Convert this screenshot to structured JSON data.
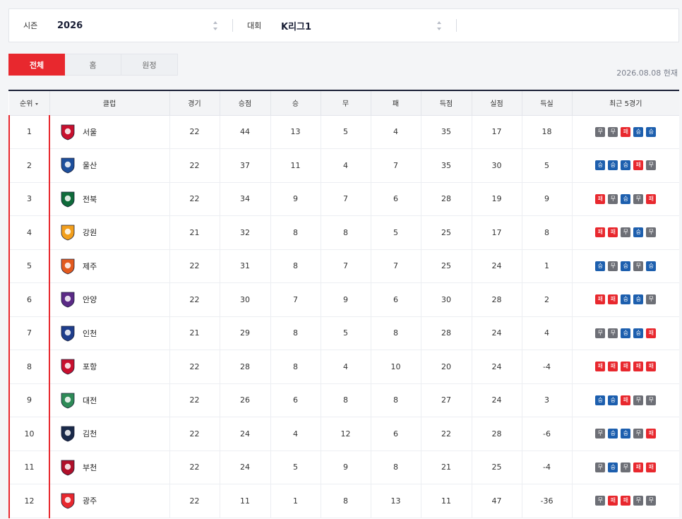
{
  "filters": {
    "season_label": "시즌",
    "season_value": "2026",
    "competition_label": "대회",
    "competition_value": "K리그1"
  },
  "tabs": [
    {
      "label": "전체",
      "active": true
    },
    {
      "label": "홈",
      "active": false
    },
    {
      "label": "원정",
      "active": false
    }
  ],
  "as_of": "2026.08.08 현재",
  "table": {
    "headers": {
      "rank": "순위",
      "club": "클럽",
      "played": "경기",
      "points": "승점",
      "won": "승",
      "drawn": "무",
      "lost": "패",
      "gf": "득점",
      "ga": "실점",
      "gd": "득실",
      "recent": "최근 5경기"
    },
    "result_labels": {
      "W": "승",
      "D": "무",
      "L": "패"
    },
    "colors": {
      "win": "#1d5fae",
      "draw": "#6d6f76",
      "loss": "#e8282e",
      "accent": "#e8282e"
    },
    "rows": [
      {
        "rank": "1",
        "club": "서울",
        "crest_color": "#c8102e",
        "played": "22",
        "points": "44",
        "won": "13",
        "drawn": "5",
        "lost": "4",
        "gf": "35",
        "ga": "17",
        "gd": "18",
        "recent": [
          "D",
          "D",
          "L",
          "W",
          "W"
        ]
      },
      {
        "rank": "2",
        "club": "울산",
        "crest_color": "#1d4f9c",
        "played": "22",
        "points": "37",
        "won": "11",
        "drawn": "4",
        "lost": "7",
        "gf": "35",
        "ga": "30",
        "gd": "5",
        "recent": [
          "W",
          "W",
          "W",
          "L",
          "D"
        ]
      },
      {
        "rank": "3",
        "club": "전북",
        "crest_color": "#0f6b3a",
        "played": "22",
        "points": "34",
        "won": "9",
        "drawn": "7",
        "lost": "6",
        "gf": "28",
        "ga": "19",
        "gd": "9",
        "recent": [
          "L",
          "D",
          "W",
          "D",
          "L"
        ]
      },
      {
        "rank": "4",
        "club": "강원",
        "crest_color": "#f29f1c",
        "played": "21",
        "points": "32",
        "won": "8",
        "drawn": "8",
        "lost": "5",
        "gf": "25",
        "ga": "17",
        "gd": "8",
        "recent": [
          "L",
          "L",
          "D",
          "W",
          "D"
        ]
      },
      {
        "rank": "5",
        "club": "제주",
        "crest_color": "#e35a1e",
        "played": "22",
        "points": "31",
        "won": "8",
        "drawn": "7",
        "lost": "7",
        "gf": "25",
        "ga": "24",
        "gd": "1",
        "recent": [
          "W",
          "D",
          "W",
          "D",
          "W"
        ]
      },
      {
        "rank": "6",
        "club": "안양",
        "crest_color": "#5b2a86",
        "played": "22",
        "points": "30",
        "won": "7",
        "drawn": "9",
        "lost": "6",
        "gf": "30",
        "ga": "28",
        "gd": "2",
        "recent": [
          "L",
          "L",
          "W",
          "W",
          "D"
        ]
      },
      {
        "rank": "7",
        "club": "인천",
        "crest_color": "#1f3e8c",
        "played": "21",
        "points": "29",
        "won": "8",
        "drawn": "5",
        "lost": "8",
        "gf": "28",
        "ga": "24",
        "gd": "4",
        "recent": [
          "D",
          "D",
          "W",
          "W",
          "L"
        ]
      },
      {
        "rank": "8",
        "club": "포항",
        "crest_color": "#c8102e",
        "played": "22",
        "points": "28",
        "won": "8",
        "drawn": "4",
        "lost": "10",
        "gf": "20",
        "ga": "24",
        "gd": "-4",
        "recent": [
          "L",
          "L",
          "L",
          "L",
          "L"
        ]
      },
      {
        "rank": "9",
        "club": "대전",
        "crest_color": "#2e8b57",
        "played": "22",
        "points": "26",
        "won": "6",
        "drawn": "8",
        "lost": "8",
        "gf": "27",
        "ga": "24",
        "gd": "3",
        "recent": [
          "W",
          "W",
          "L",
          "D",
          "D"
        ]
      },
      {
        "rank": "10",
        "club": "김천",
        "crest_color": "#1a2a4a",
        "played": "22",
        "points": "24",
        "won": "4",
        "drawn": "12",
        "lost": "6",
        "gf": "22",
        "ga": "28",
        "gd": "-6",
        "recent": [
          "D",
          "W",
          "W",
          "D",
          "L"
        ]
      },
      {
        "rank": "11",
        "club": "부천",
        "crest_color": "#b0102a",
        "played": "22",
        "points": "24",
        "won": "5",
        "drawn": "9",
        "lost": "8",
        "gf": "21",
        "ga": "25",
        "gd": "-4",
        "recent": [
          "D",
          "W",
          "D",
          "L",
          "L"
        ]
      },
      {
        "rank": "12",
        "club": "광주",
        "crest_color": "#e8282e",
        "played": "22",
        "points": "11",
        "won": "1",
        "drawn": "8",
        "lost": "13",
        "gf": "11",
        "ga": "47",
        "gd": "-36",
        "recent": [
          "D",
          "L",
          "L",
          "D",
          "D"
        ]
      }
    ]
  }
}
